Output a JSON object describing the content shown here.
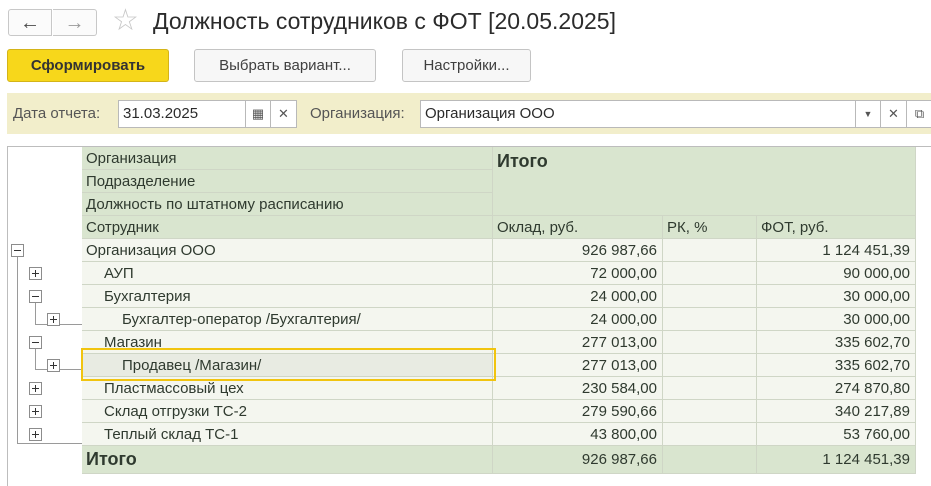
{
  "header": {
    "back_icon": "arrow-left-icon",
    "forward_icon": "arrow-right-icon",
    "favorite_icon": "star-icon",
    "title": "Должность сотрудников с ФОТ [20.05.2025]"
  },
  "toolbar": {
    "generate_label": "Сформировать",
    "variant_label": "Выбрать вариант...",
    "settings_label": "Настройки..."
  },
  "params": {
    "date_label": "Дата отчета:",
    "date_value": "31.03.2025",
    "org_label": "Организация:",
    "org_value": "Организация ООО"
  },
  "report": {
    "headers": {
      "group1": "Организация",
      "group2": "Подразделение",
      "group3": "Должность по штатному расписанию",
      "group4": "Сотрудник",
      "total": "Итого",
      "salary": "Оклад, руб.",
      "rk": "РК, %",
      "fot": "ФОТ, руб."
    },
    "rows": [
      {
        "name": "Организация ООО",
        "salary": "926 987,66",
        "rk": "",
        "fot": "1 124 451,39"
      },
      {
        "name": "АУП",
        "salary": "72 000,00",
        "rk": "",
        "fot": "90 000,00"
      },
      {
        "name": "Бухгалтерия",
        "salary": "24 000,00",
        "rk": "",
        "fot": "30 000,00"
      },
      {
        "name": "Бухгалтер-оператор /Бухгалтерия/",
        "salary": "24 000,00",
        "rk": "",
        "fot": "30 000,00"
      },
      {
        "name": "Магазин",
        "salary": "277 013,00",
        "rk": "",
        "fot": "335 602,70"
      },
      {
        "name": "Продавец /Магазин/",
        "salary": "277 013,00",
        "rk": "",
        "fot": "335 602,70"
      },
      {
        "name": "Пластмассовый цех",
        "salary": "230 584,00",
        "rk": "",
        "fot": "274 870,80"
      },
      {
        "name": "Склад отгрузки ТС-2",
        "salary": "279 590,66",
        "rk": "",
        "fot": "340 217,89"
      },
      {
        "name": "Теплый склад ТС-1",
        "salary": "43 800,00",
        "rk": "",
        "fot": "53 760,00"
      }
    ],
    "total_row": {
      "name": "Итого",
      "salary": "926 987,66",
      "rk": "",
      "fot": "1 124 451,39"
    }
  }
}
